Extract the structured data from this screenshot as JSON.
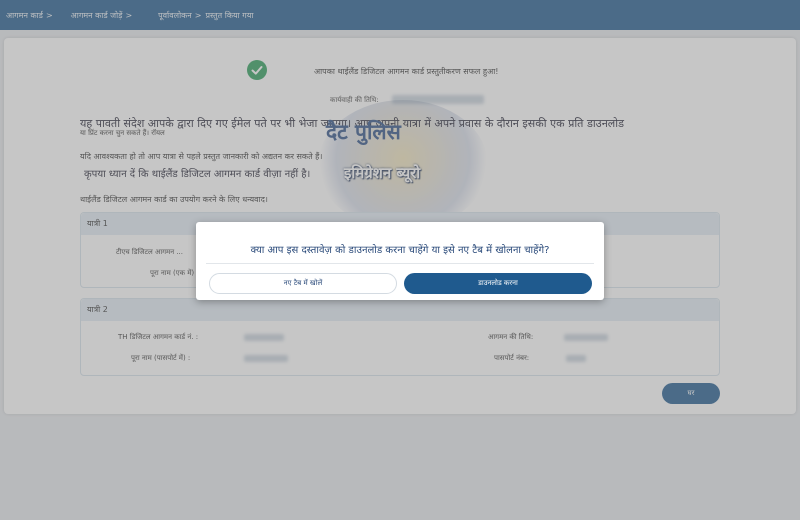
{
  "breadcrumbs": [
    {
      "label": "आगमन कार्ड",
      "sep": ">"
    },
    {
      "label": "आगमन कार्ड जोड़ें",
      "sep": ">"
    },
    {
      "label": "पूर्वावलोकन",
      "sep": ">"
    },
    {
      "label": "प्रस्तुत किया गया",
      "sep": ""
    }
  ],
  "success": {
    "message": "आपका थाईलैंड डिजिटल आगमन कार्ड प्रस्तुतीकरण सफल हुआ!",
    "date_label": "कार्यवाही की तिथि:",
    "icon": "check-circle-icon",
    "icon_color": "#2a9d5a"
  },
  "info": {
    "line1": "यह पावती संदेश आपके द्वारा दिए गए ईमेल पते पर भी भेजा जाएगा। आप अपनी यात्रा में अपने प्रवास के दौरान इसकी एक प्रति डाउनलोड",
    "line2": "या प्रिंट करना चुन सकते हैं। रॉयल",
    "line3": "यदि आवश्यकता हो तो आप यात्रा से पहले प्रस्तुत जानकारी को अद्यतन कर सकते हैं।",
    "line4": "कृपया ध्यान दें कि थाईलैंड डिजिटल आगमन कार्ड वीज़ा नहीं है।",
    "line5": "थाईलैंड डिजिटल आगमन कार्ड का उपयोग करने के लिए धन्यवाद।"
  },
  "watermark": {
    "line1": "दैट पुलिस",
    "line2": "इमिग्रेशन ब्यूरो"
  },
  "traveler1": {
    "title": "यात्री 1",
    "card_no_label": "टीएच डिजिटल आगमन ...",
    "name_label": "पूरा नाम (एक में)"
  },
  "traveler2": {
    "title": "यात्री 2",
    "card_no_label": "TH डिजिटल आगमन कार्ड नं. :",
    "name_label": "पूरा नाम (पासपोर्ट में) :",
    "arrival_label": "आगमन की तिथि:",
    "passport_label": "पासपोर्ट नंबर:"
  },
  "home_button": "घर",
  "modal": {
    "question": "क्या आप इस दस्तावेज़ को डाउनलोड करना चाहेंगे या इसे नए टैब में खोलना चाहेंगे?",
    "open_new_tab": "नए टैब में खोलें",
    "download": "डाउनलोड करना"
  },
  "colors": {
    "brand": "#1f5a8e",
    "success": "#2a9d5a",
    "section_header": "#e2ecf4"
  }
}
